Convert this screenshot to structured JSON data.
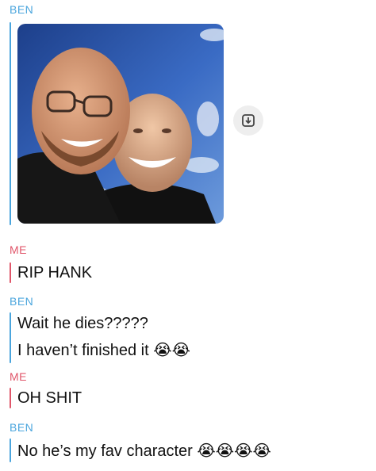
{
  "messages": [
    {
      "sender": "BEN",
      "type": "photo",
      "photo_alt": ""
    },
    {
      "sender": "ME",
      "lines": [
        "RIP HANK"
      ]
    },
    {
      "sender": "BEN",
      "lines": [
        "Wait he dies?????",
        "I haven’t finished it"
      ],
      "emoji_line2": "😭😭"
    },
    {
      "sender": "ME",
      "lines": [
        "OH SHIT"
      ]
    },
    {
      "sender": "BEN",
      "lines": [
        "No he’s my fav character"
      ],
      "emoji_line1": "😭😭😭😭"
    }
  ],
  "icons": {
    "save": "save-to-camera-roll-icon"
  },
  "colors": {
    "ben": "#4aa5dd",
    "me": "#e0566a"
  }
}
